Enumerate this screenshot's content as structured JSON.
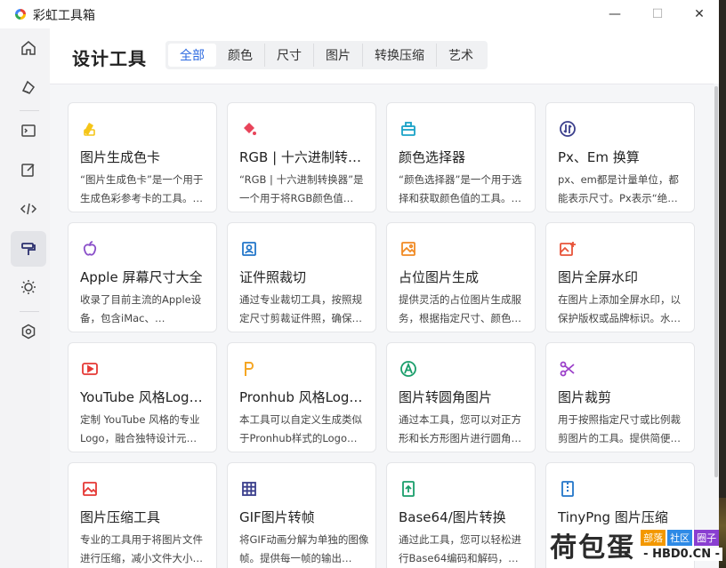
{
  "app": {
    "title": "彩虹工具箱"
  },
  "window_controls": {
    "minimize": "—",
    "maximize": "☐",
    "close": "✕"
  },
  "header": {
    "title": "设计工具",
    "tabs": [
      {
        "label": "全部",
        "active": true
      },
      {
        "label": "颜色",
        "active": false
      },
      {
        "label": "尺寸",
        "active": false
      },
      {
        "label": "图片",
        "active": false
      },
      {
        "label": "转换压缩",
        "active": false
      },
      {
        "label": "艺术",
        "active": false
      }
    ]
  },
  "sidebar": {
    "items": [
      {
        "icon": "home-icon",
        "active": false
      },
      {
        "icon": "palette-icon",
        "active": false
      },
      {
        "icon": "terminal-icon",
        "active": false
      },
      {
        "icon": "edit-icon",
        "active": false
      },
      {
        "icon": "code-icon",
        "active": false
      },
      {
        "icon": "paint-roller-icon",
        "active": true
      },
      {
        "icon": "sun-icon",
        "active": false
      },
      {
        "icon": "settings-icon",
        "active": false
      }
    ]
  },
  "cards": [
    {
      "title": "图片生成色卡",
      "desc": "“图片生成色卡”是一个用于生成色彩参考卡的工具。…",
      "icon": "swatch-icon",
      "color": "#f5c518"
    },
    {
      "title": "RGB | 十六进制转换器",
      "desc": "“RGB | 十六进制转换器”是一个用于将RGB颜色值…",
      "icon": "paint-bucket-icon",
      "color": "#e8445a"
    },
    {
      "title": "颜色选择器",
      "desc": "“颜色选择器”是一个用于选择和获取颜色值的工具。…",
      "icon": "color-picker-icon",
      "color": "#1aa2c7"
    },
    {
      "title": "Px、Em 换算",
      "desc": "px、em都是计量单位，都能表示尺寸。Px表示“绝…",
      "icon": "convert-icon",
      "color": "#3b3f8c"
    },
    {
      "title": "Apple 屏幕尺寸大全",
      "desc": "收录了目前主流的Apple设备，包含iMac、…",
      "icon": "apple-icon",
      "color": "#8a4fc9"
    },
    {
      "title": "证件照裁切",
      "desc": "通过专业裁切工具，按照规定尺寸剪裁证件照，确保…",
      "icon": "id-photo-icon",
      "color": "#2276c9"
    },
    {
      "title": "占位图片生成",
      "desc": "提供灵活的占位图片生成服务，根据指定尺寸、颜色…",
      "icon": "image-placeholder-icon",
      "color": "#f08a24"
    },
    {
      "title": "图片全屏水印",
      "desc": "在图片上添加全屏水印，以保护版权或品牌标识。水…",
      "icon": "image-watermark-icon",
      "color": "#e8543a"
    },
    {
      "title": "YouTube 风格Logo生成",
      "desc": "定制 YouTube 风格的专业Logo，融合独特设计元…",
      "icon": "youtube-icon",
      "color": "#e53935"
    },
    {
      "title": "Pronhub 风格Logo生成",
      "desc": "本工具可以自定义生成类似于Pronhub样式的Logo…",
      "icon": "letter-p-icon",
      "color": "#f5a623"
    },
    {
      "title": "图片转圆角图片",
      "desc": "通过本工具，您可以对正方形和长方形图片进行圆角…",
      "icon": "rounded-image-icon",
      "color": "#1a9e6b"
    },
    {
      "title": "图片裁剪",
      "desc": "用于按照指定尺寸或比例裁剪图片的工具。提供简便…",
      "icon": "scissors-icon",
      "color": "#9b3fc9"
    },
    {
      "title": "图片压缩工具",
      "desc": "专业的工具用于将图片文件进行压缩，减小文件大小…",
      "icon": "image-compress-icon",
      "color": "#e53935"
    },
    {
      "title": "GIF图片转帧",
      "desc": "将GIF动画分解为单独的图像帧。提供每一帧的输出…",
      "icon": "grid-icon",
      "color": "#3b3f8c"
    },
    {
      "title": "Base64/图片转换",
      "desc": "通过此工具，您可以轻松进行Base64编码和解码，…",
      "icon": "upload-file-icon",
      "color": "#1a9e6b"
    },
    {
      "title": "TinyPng 图片压缩",
      "desc": "",
      "icon": "zip-file-icon",
      "color": "#2276c9"
    }
  ],
  "watermark": {
    "text": "荷包蛋",
    "tags": [
      {
        "label": "部落",
        "color": "#f39800"
      },
      {
        "label": "社区",
        "color": "#2e8ae6"
      },
      {
        "label": "圈子",
        "color": "#8a3fd1"
      }
    ],
    "domain": "- HBD0.CN -"
  }
}
